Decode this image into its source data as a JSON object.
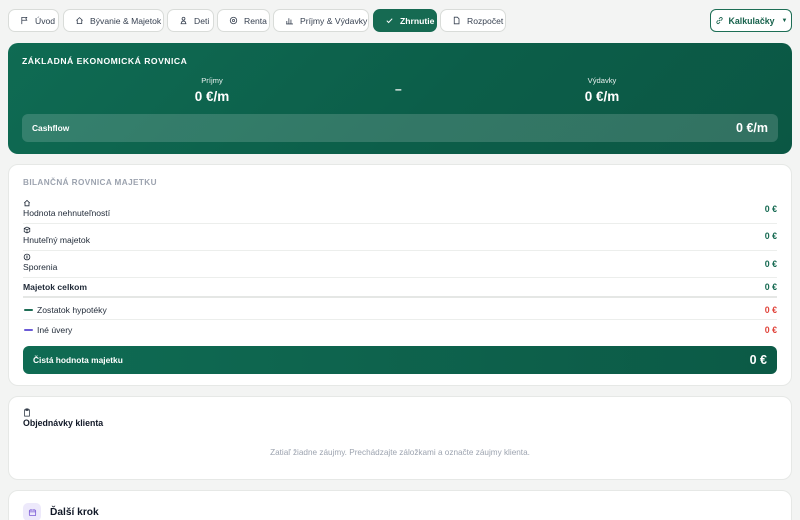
{
  "nav": {
    "tabs": [
      {
        "label": "Úvod",
        "icon": "flag-icon",
        "active": false
      },
      {
        "label": "Bývanie & Majetok",
        "icon": "home-icon",
        "active": false
      },
      {
        "label": "Deti",
        "icon": "child-icon",
        "active": false
      },
      {
        "label": "Renta",
        "icon": "coin-icon",
        "active": false
      },
      {
        "label": "Príjmy & Výdavky",
        "icon": "bar-chart-icon",
        "active": false
      },
      {
        "label": "Zhrnutie",
        "icon": "check-icon",
        "active": true
      },
      {
        "label": "Rozpočet",
        "icon": "document-icon",
        "active": false
      }
    ],
    "calculators_label": "Kalkulačky",
    "calculators_icon": "link-icon"
  },
  "equation": {
    "title": "ZÁKLADNÁ EKONOMICKÁ ROVNICA",
    "income_label": "Príjmy",
    "income_value": "0 €/m",
    "operator": "–",
    "expenses_label": "Výdavky",
    "expenses_value": "0 €/m",
    "cashflow_label": "Cashflow",
    "cashflow_value": "0 €/m"
  },
  "balance": {
    "title": "BILANČNÁ ROVNICA MAJETKU",
    "assets": [
      {
        "label": "Hodnota nehnuteľností",
        "value": "0 €",
        "icon": "home-icon"
      },
      {
        "label": "Hnuteľný majetok",
        "value": "0 €",
        "icon": "box-icon"
      },
      {
        "label": "Sporenia",
        "value": "0 €",
        "icon": "coin-icon"
      }
    ],
    "total_label": "Majetok celkom",
    "total_value": "0 €",
    "liabilities": [
      {
        "label": "Zostatok hypotéky",
        "value": "0 €",
        "dash_color": "#1f6e56"
      },
      {
        "label": "Iné úvery",
        "value": "0 €",
        "dash_color": "#6b5bd6"
      }
    ],
    "net_label": "Čistá hodnota majetku",
    "net_value": "0 €"
  },
  "orders": {
    "title": "Objednávky klienta",
    "icon": "clipboard-icon",
    "empty_text": "Zatiaľ žiadne záujmy. Prechádzajte záložkami a označte záujmy klienta."
  },
  "next_step": {
    "title": "Ďalší krok",
    "icon": "calendar-icon"
  },
  "colors": {
    "brand": "#166a52",
    "negative": "#e0443b",
    "positive": "#166a52"
  }
}
